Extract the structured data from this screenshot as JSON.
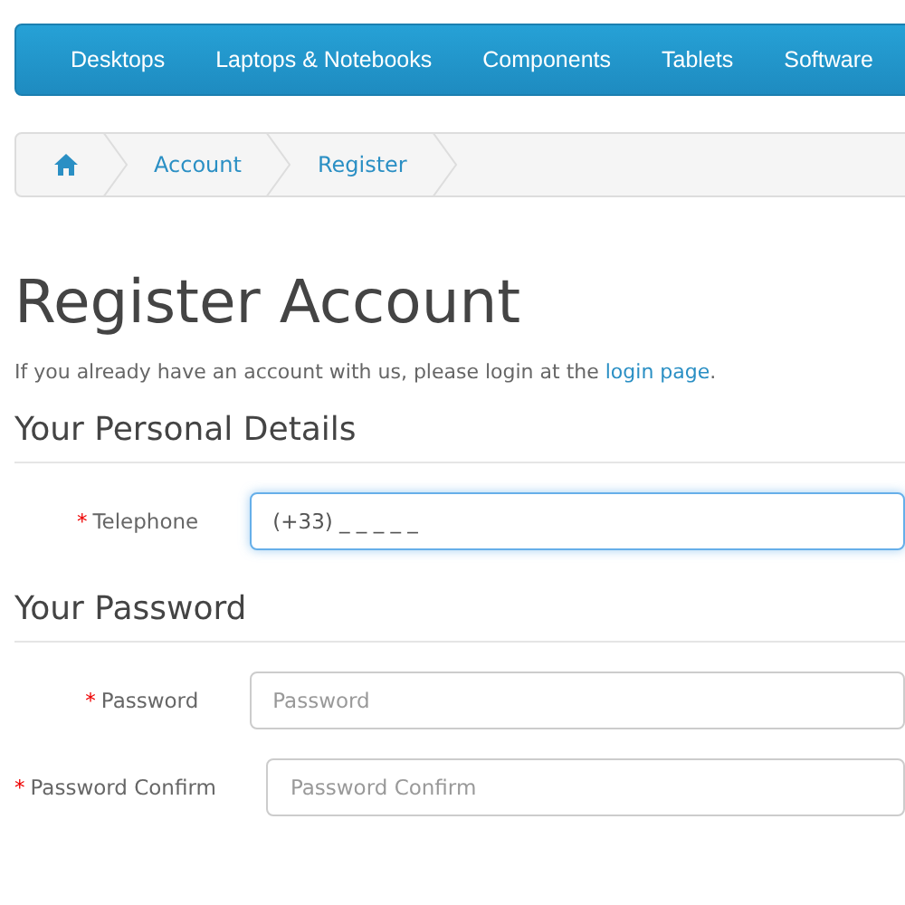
{
  "menu": [
    {
      "label": "Desktops"
    },
    {
      "label": "Laptops & Notebooks"
    },
    {
      "label": "Components"
    },
    {
      "label": "Tablets"
    },
    {
      "label": "Software"
    }
  ],
  "breadcrumb": [
    {
      "label": "Account"
    },
    {
      "label": "Register"
    }
  ],
  "title": "Register Account",
  "intro": {
    "text": "If you already have an account with us, please login at the ",
    "link": "login page",
    "end": "."
  },
  "sections": [
    {
      "heading": "Your Personal Details",
      "fields": [
        {
          "label": "Telephone",
          "required_mark": "*",
          "value": "(+33) _ _ _ _ _",
          "focused": true
        }
      ]
    },
    {
      "heading": "Your Password",
      "fields": [
        {
          "label": "Password",
          "required_mark": "*",
          "placeholder": "Password",
          "focused": false
        },
        {
          "label": "Password Confirm",
          "required_mark": "*",
          "placeholder": "Password Confirm",
          "focused": false
        }
      ]
    }
  ]
}
